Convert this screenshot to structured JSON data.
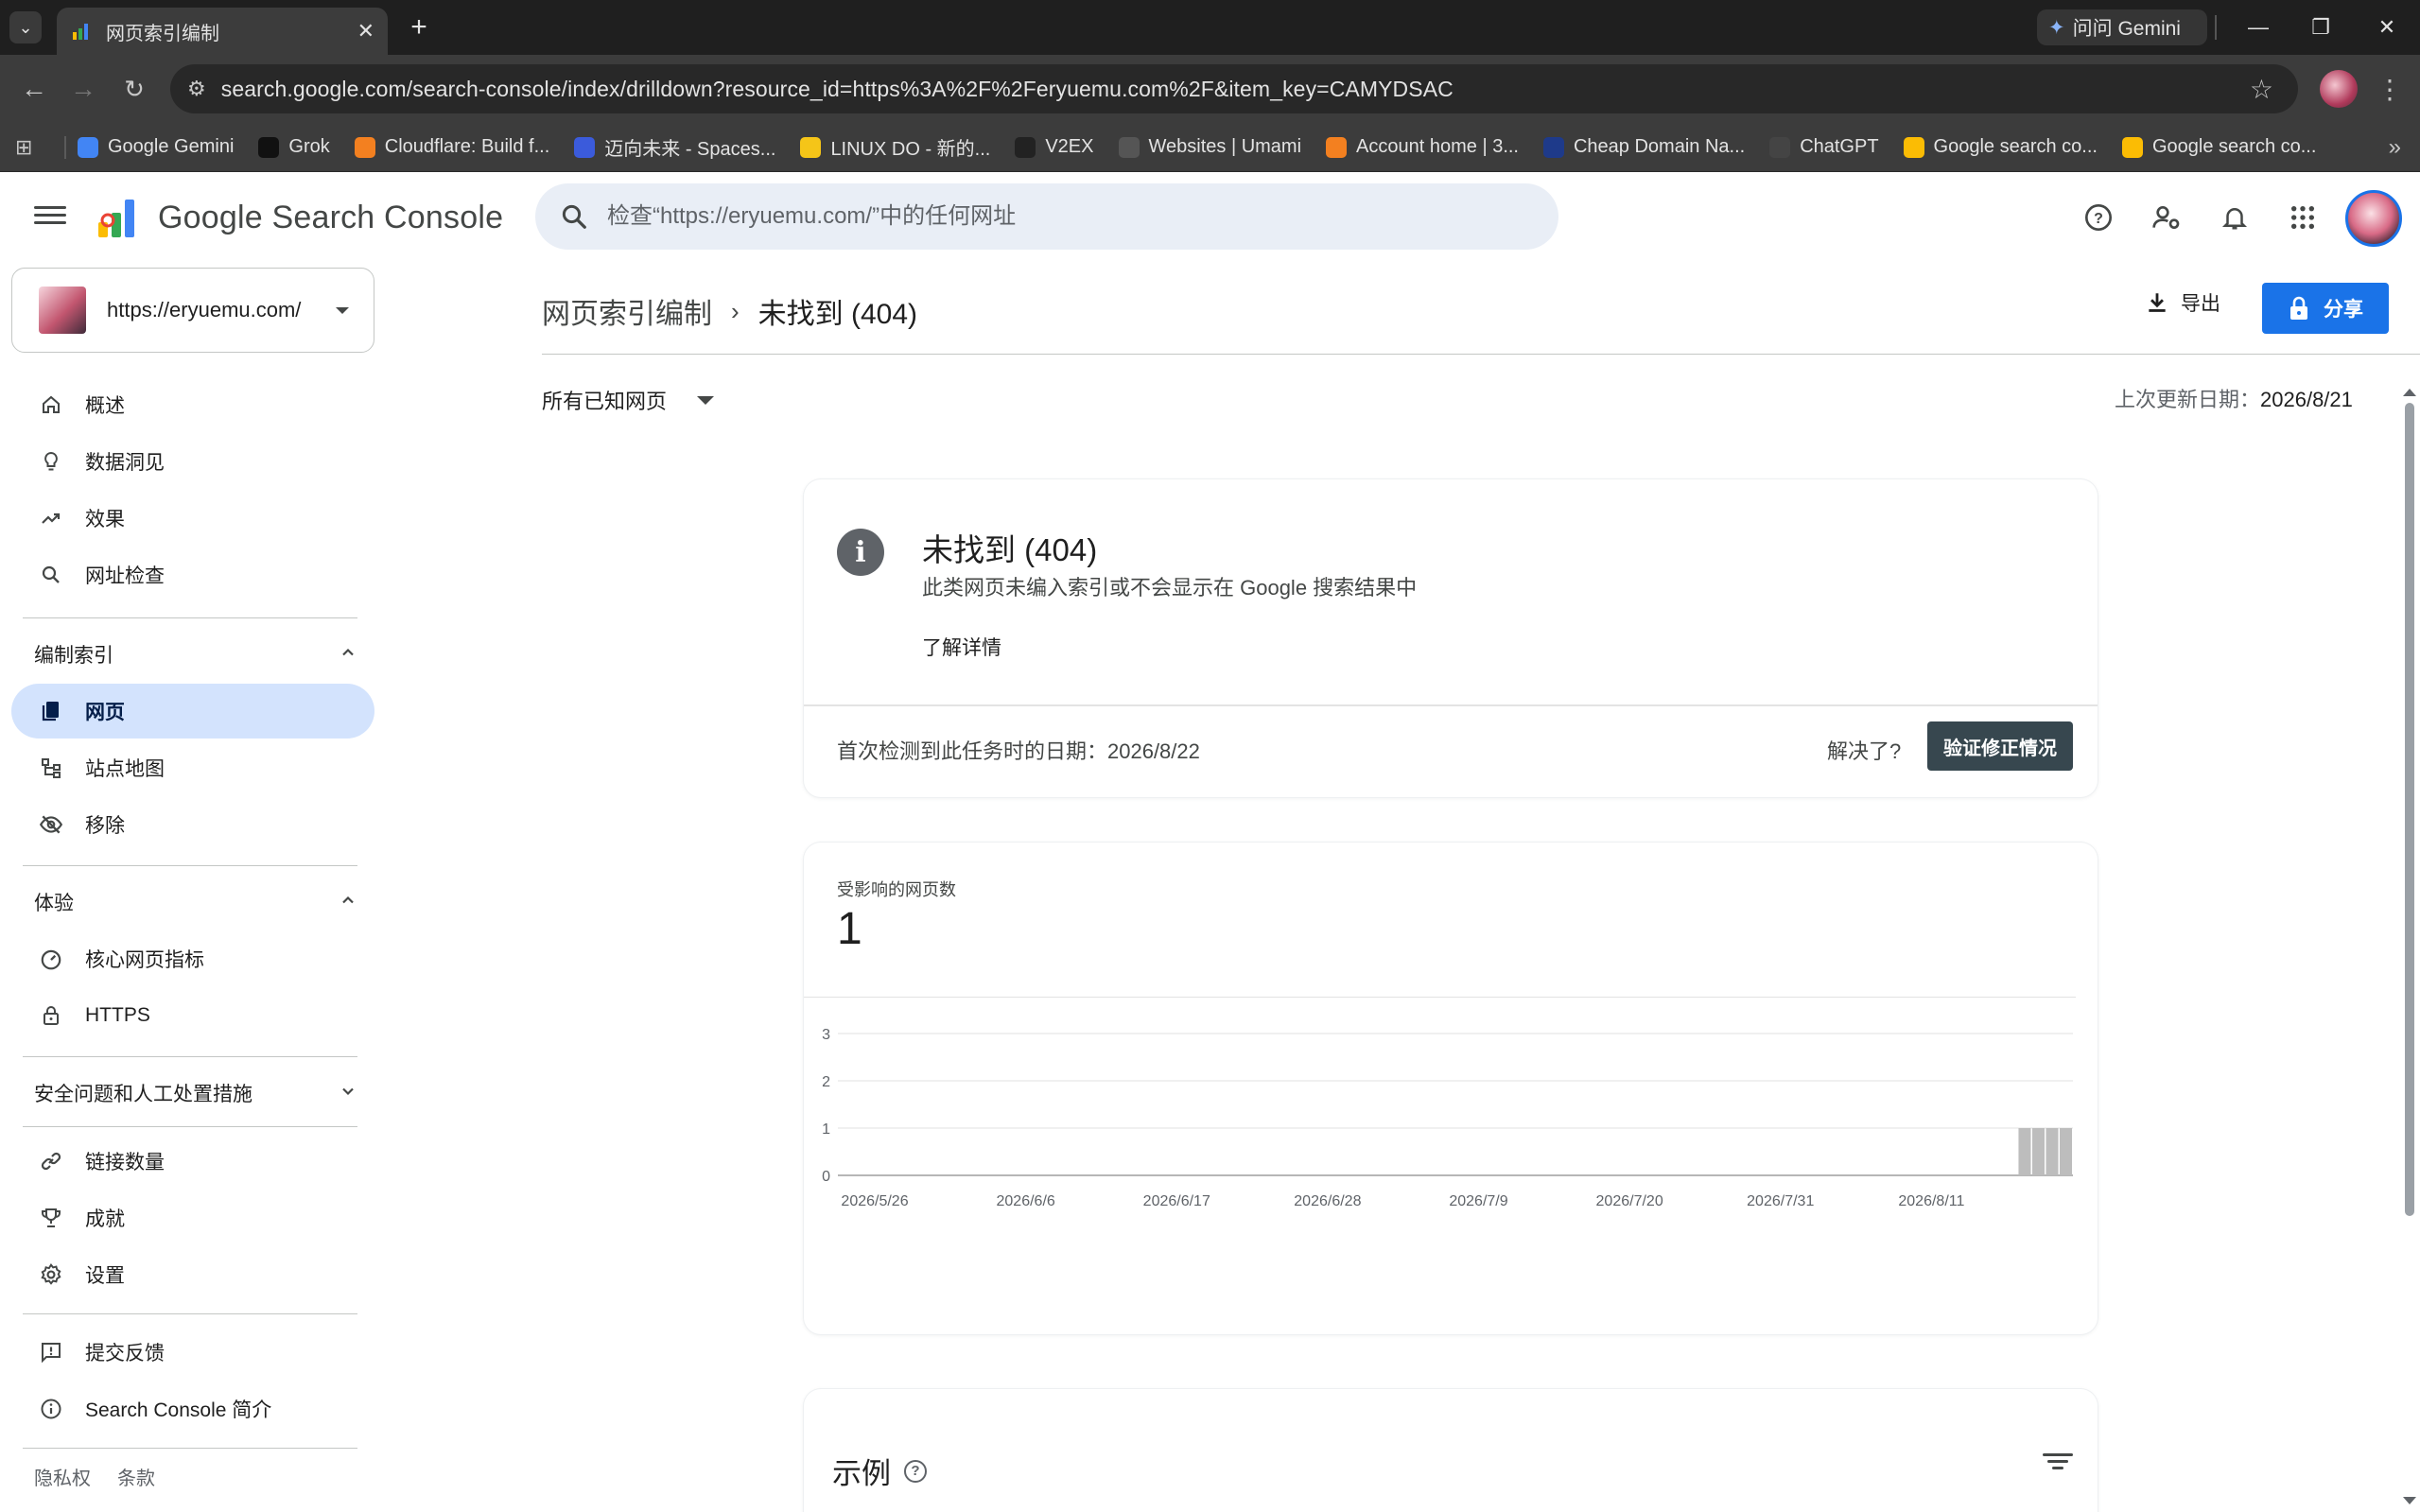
{
  "browser": {
    "tab_title": "网页索引编制",
    "gemini_label": "问问 Gemini",
    "url": "search.google.com/search-console/index/drilldown?resource_id=https%3A%2F%2Feryuemu.com%2F&item_key=CAMYDSAC",
    "bookmarks": [
      {
        "label": "Google Gemini",
        "icon": "gemini-icon",
        "color": "#4285f4"
      },
      {
        "label": "Grok",
        "icon": "grok-icon",
        "color": "#111111"
      },
      {
        "label": "Cloudflare: Build f...",
        "icon": "cloudflare-icon",
        "color": "#f38020"
      },
      {
        "label": "迈向未来 - Spaces...",
        "icon": "spaces-icon",
        "color": "#3b5bdb"
      },
      {
        "label": "LINUX DO - 新的...",
        "icon": "linuxdo-icon",
        "color": "#f5c518"
      },
      {
        "label": "V2EX",
        "icon": "v2ex-icon",
        "color": "#222222"
      },
      {
        "label": "Websites | Umami",
        "icon": "umami-icon",
        "color": "#555555"
      },
      {
        "label": "Account home | 3...",
        "icon": "cloud-icon",
        "color": "#f38020"
      },
      {
        "label": "Cheap Domain Na...",
        "icon": "namecheap-icon",
        "color": "#1e3a8a"
      },
      {
        "label": "ChatGPT",
        "icon": "chatgpt-icon",
        "color": "#444444"
      },
      {
        "label": "Google search co...",
        "icon": "gsc-icon",
        "color": "#fbbc04"
      },
      {
        "label": "Google search co...",
        "icon": "gsc-icon",
        "color": "#fbbc04"
      }
    ]
  },
  "app": {
    "brand": "Google Search Console",
    "search_placeholder": "检查“https://eryuemu.com/”中的任何网址",
    "property": "https://eryuemu.com/"
  },
  "sidebar": {
    "items_top": [
      {
        "label": "概述",
        "icon": "home-icon"
      },
      {
        "label": "数据洞见",
        "icon": "lightbulb-icon"
      },
      {
        "label": "效果",
        "icon": "trending-icon"
      },
      {
        "label": "网址检查",
        "icon": "search-icon"
      }
    ],
    "section_index": "编制索引",
    "items_index": [
      {
        "label": "网页",
        "icon": "pages-icon",
        "active": true
      },
      {
        "label": "站点地图",
        "icon": "sitemap-icon"
      },
      {
        "label": "移除",
        "icon": "eye-off-icon"
      }
    ],
    "section_experience": "体验",
    "items_experience": [
      {
        "label": "核心网页指标",
        "icon": "speed-icon"
      },
      {
        "label": "HTTPS",
        "icon": "lock-icon"
      }
    ],
    "section_security": "安全问题和人工处置措施",
    "items_more": [
      {
        "label": "链接数量",
        "icon": "link-icon"
      },
      {
        "label": "成就",
        "icon": "trophy-icon"
      },
      {
        "label": "设置",
        "icon": "gear-icon"
      }
    ],
    "items_bottom": [
      {
        "label": "提交反馈",
        "icon": "feedback-icon"
      },
      {
        "label": "Search Console 简介",
        "icon": "info-icon"
      }
    ],
    "footer": {
      "privacy": "隐私权",
      "terms": "条款"
    }
  },
  "main": {
    "breadcrumb_parent": "网页索引编制",
    "breadcrumb_current": "未找到 (404)",
    "export_label": "导出",
    "share_label": "分享",
    "filter_label": "所有已知网页",
    "last_updated_label": "上次更新日期：",
    "last_updated_date": "2026/8/21"
  },
  "issue": {
    "title": "未找到 (404)",
    "description": "此类网页未编入索引或不会显示在 Google 搜索结果中",
    "learn_more": "了解详情",
    "first_detected": "首次检测到此任务时的日期：2026/8/22",
    "resolved_question": "解决了?",
    "validate_button": "验证修正情况"
  },
  "affected": {
    "label": "受影响的网页数",
    "count": "1"
  },
  "examples": {
    "title": "示例"
  },
  "colors": {
    "accent": "#1a73e8",
    "active_nav_bg": "#d3e3fd",
    "bar_color": "#bdbdbd",
    "validate_btn": "#37474f"
  },
  "chart_data": {
    "type": "bar",
    "title": "",
    "xlabel": "",
    "ylabel": "",
    "ylim": [
      0,
      3
    ],
    "yticks": [
      0,
      1,
      2,
      3
    ],
    "x_tick_labels": [
      "2026/5/26",
      "2026/6/6",
      "2026/6/17",
      "2026/6/28",
      "2026/7/9",
      "2026/7/20",
      "2026/7/31",
      "2026/8/11"
    ],
    "x_range": [
      "2026/5/24",
      "2026/8/21"
    ],
    "categories": [
      "2026/8/18",
      "2026/8/19",
      "2026/8/20",
      "2026/8/21"
    ],
    "values": [
      1,
      1,
      1,
      1
    ],
    "grid": true
  }
}
